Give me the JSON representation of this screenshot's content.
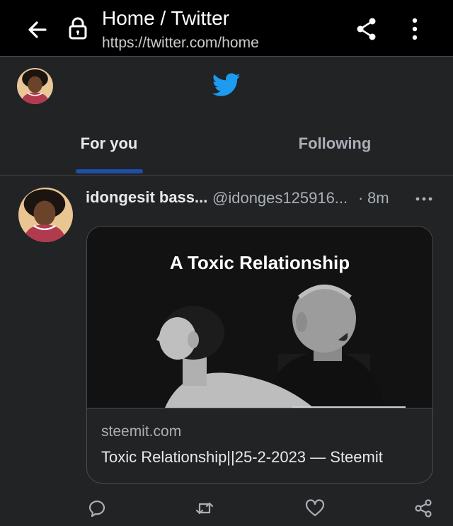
{
  "browser": {
    "title": "Home / Twitter",
    "url": "https://twitter.com/home",
    "icons": [
      "back-arrow-icon",
      "lock-icon",
      "share-icon",
      "overflow-menu-icon"
    ]
  },
  "header": {
    "logo": "twitter-bird-icon",
    "logo_color": "#1d9bf0",
    "tabs": [
      {
        "label": "For you",
        "selected": true
      },
      {
        "label": "Following",
        "selected": false
      }
    ],
    "indicator_color": "#1d4ea8"
  },
  "tweet": {
    "author_name": "idongesit bass...",
    "handle": "@idonges125916...",
    "separator": "·",
    "time": "8m",
    "card": {
      "image_title": "A Toxic Relationship",
      "domain": "steemit.com",
      "title": "Toxic Relationship||25-2-2023 — Steemit"
    },
    "actions": [
      "reply-icon",
      "retweet-icon",
      "like-icon",
      "share-icon"
    ]
  }
}
